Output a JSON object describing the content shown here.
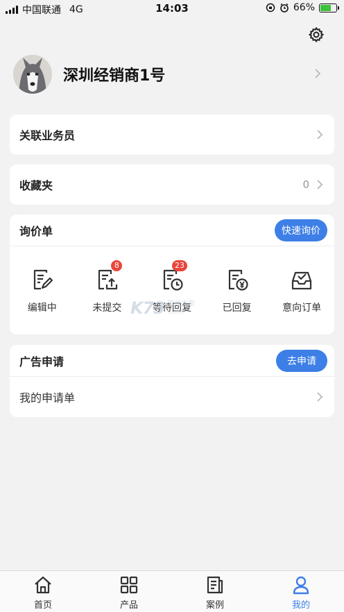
{
  "status": {
    "carrier": "中国联通",
    "network": "4G",
    "time": "14:03",
    "battery": "66%",
    "battery_level": 0.66
  },
  "profile": {
    "name": "深圳经销商1号"
  },
  "menu": {
    "agent_label": "关联业务员",
    "favorites_label": "收藏夹",
    "favorites_count": "0"
  },
  "inquiry": {
    "title": "询价单",
    "quick_button": "快速询价",
    "items": [
      {
        "label": "编辑中",
        "badge": ""
      },
      {
        "label": "未提交",
        "badge": "8"
      },
      {
        "label": "等待回复",
        "badge": "23"
      },
      {
        "label": "已回复",
        "badge": ""
      },
      {
        "label": "意向订单",
        "badge": ""
      }
    ]
  },
  "watermark": {
    "logo": "K73",
    "line1": "游戏之家",
    "line2": ".com"
  },
  "ad": {
    "title": "广告申请",
    "apply_button": "去申请",
    "my_applications": "我的申请单"
  },
  "tabs": [
    {
      "label": "首页",
      "icon": "home-icon"
    },
    {
      "label": "产品",
      "icon": "grid-icon"
    },
    {
      "label": "案例",
      "icon": "document-icon"
    },
    {
      "label": "我的",
      "icon": "user-icon"
    }
  ],
  "colors": {
    "accent": "#3d7fe6",
    "badge": "#e8453c",
    "background": "#f2f2f2"
  }
}
